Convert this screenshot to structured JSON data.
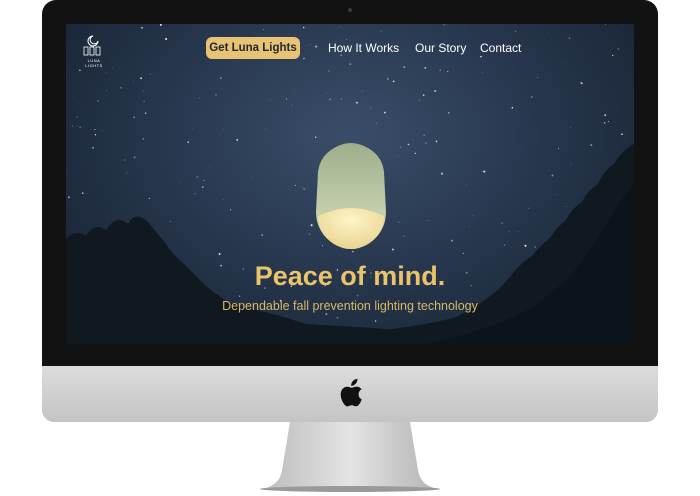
{
  "nav": {
    "cta_label": "Get Luna Lights",
    "links": [
      "How It Works",
      "Our Story",
      "Contact"
    ]
  },
  "logo": {
    "text": "LUNA LIGHTS"
  },
  "hero": {
    "headline": "Peace of mind.",
    "subheadline": "Dependable fall prevention lighting technology"
  },
  "colors": {
    "accent": "#e8c373",
    "sky": "#2a3a52",
    "lamp_body": "#b9c7a2",
    "lamp_glow": "#f1e2a8",
    "tree": "#0f171f"
  }
}
